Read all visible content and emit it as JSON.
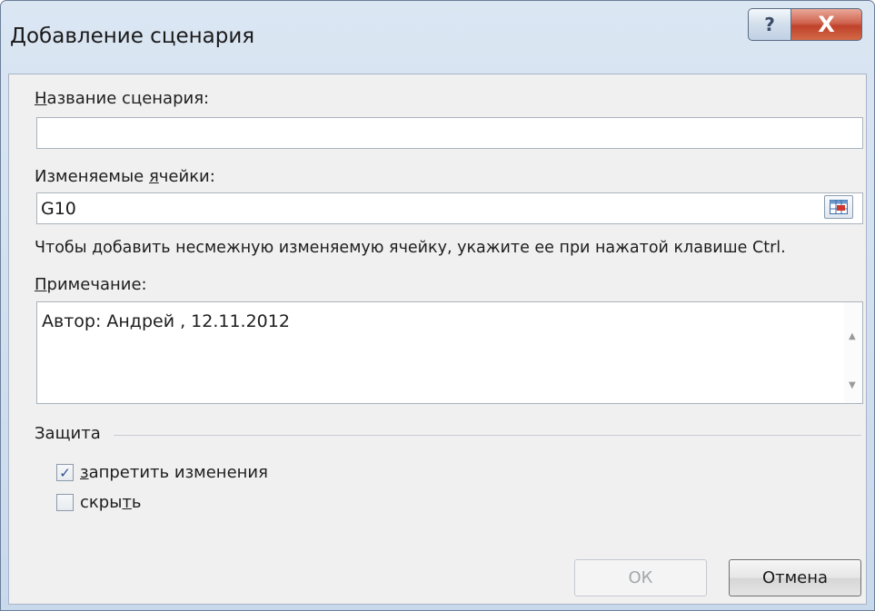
{
  "window": {
    "title": "Добавление сценария",
    "help_glyph": "?",
    "close_glyph": "X"
  },
  "form": {
    "scenario_name": {
      "label_pre": "",
      "label_key": "Н",
      "label_post": "азвание сценария:",
      "value": ""
    },
    "changing_cells": {
      "label_pre": "Изменяемые ",
      "label_key": "я",
      "label_post": "чейки:",
      "value": "G10"
    },
    "hint": "Чтобы добавить несмежную изменяемую ячейку, укажите ее при нажатой клавише Ctrl.",
    "comment": {
      "label_pre": "",
      "label_key": "П",
      "label_post": "римечание:",
      "value": "Автор: Андрей , 12.11.2012"
    }
  },
  "protection": {
    "group_label": "Защита",
    "prevent_changes": {
      "label_key": "з",
      "label_post": "апретить изменения",
      "checked": true
    },
    "hide": {
      "label_pre": "скры",
      "label_key": "т",
      "label_post": "ь",
      "checked": false
    }
  },
  "buttons": {
    "ok": "ОК",
    "cancel": "Отмена"
  },
  "colors": {
    "title_bar": "#c9d9ec",
    "close_button": "#c0412a",
    "dialog_body": "#f0f0f0",
    "check_mark": "#2a4f8f"
  },
  "icons": {
    "checkmark": "✓",
    "scroll_up": "▲",
    "scroll_down": "▼"
  }
}
